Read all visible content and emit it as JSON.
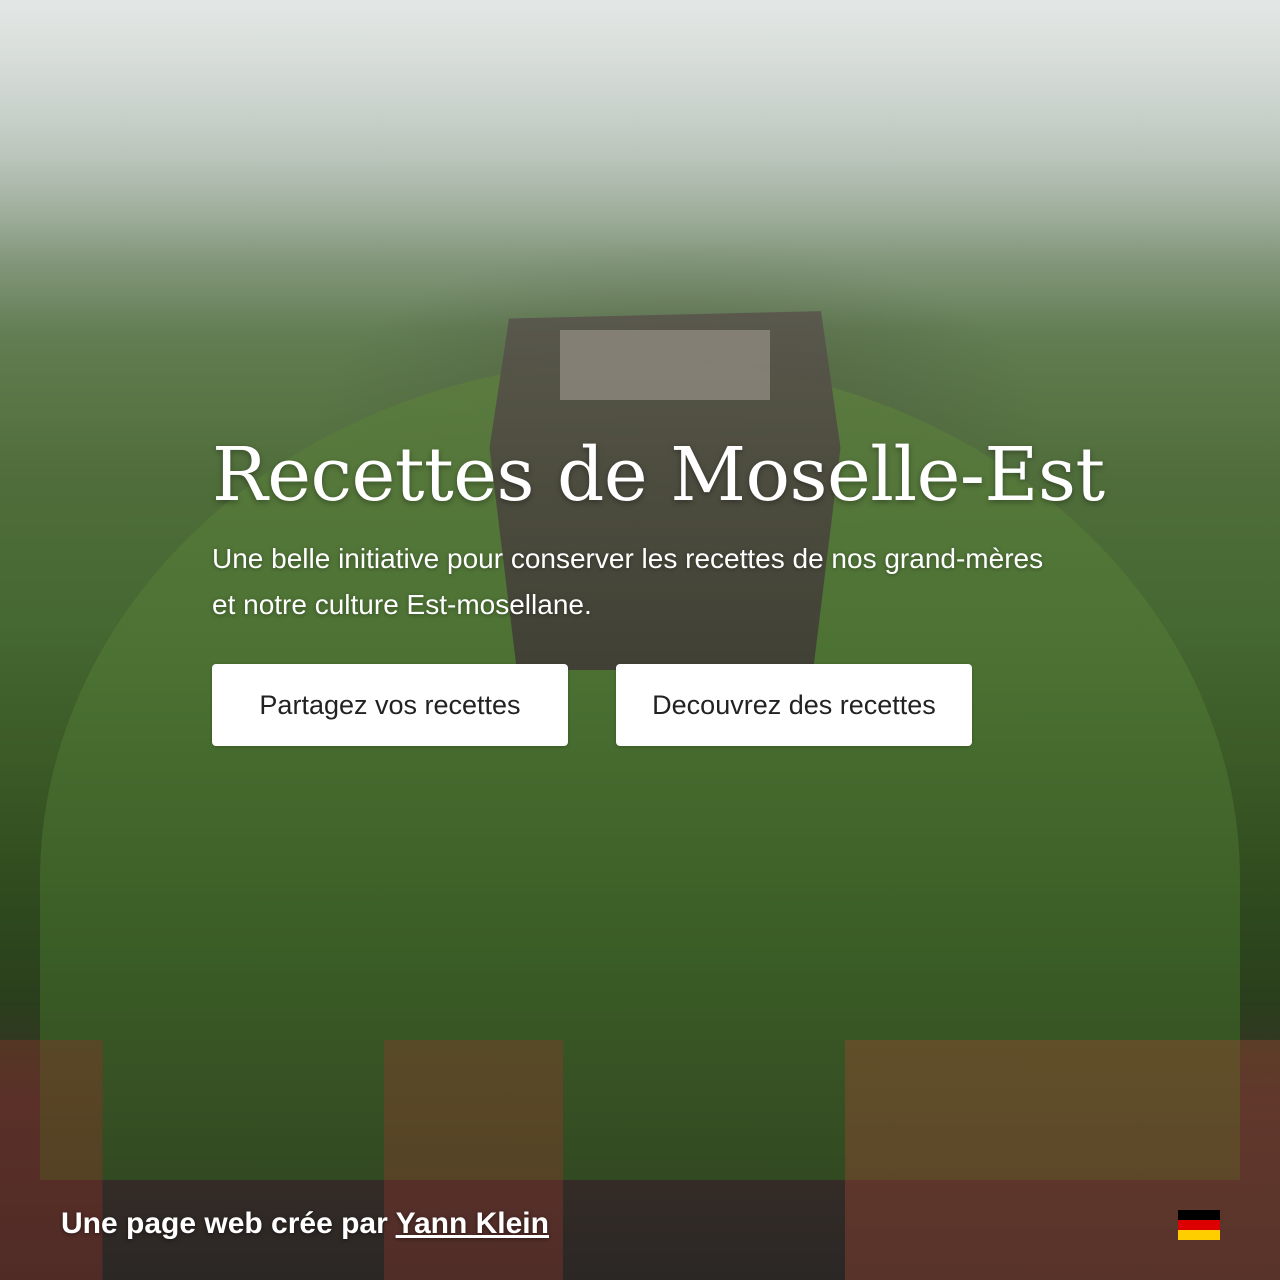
{
  "hero": {
    "title": "Recettes de Moselle-Est",
    "subtitle": "Une belle initiative pour conserver les recettes de nos grand-mères et notre culture Est-mosellane.",
    "buttons": {
      "share_label": "Partagez vos recettes",
      "discover_label": "Decouvrez des recettes"
    },
    "background_image": "aerial-view-citadel-of-bitche"
  },
  "footer": {
    "credit_prefix": "Une page web crée par",
    "author_name": "Yann Klein"
  },
  "language_switch": {
    "icon": "german-flag-icon",
    "colors": [
      "#000000",
      "#dd0000",
      "#ffce00"
    ]
  }
}
